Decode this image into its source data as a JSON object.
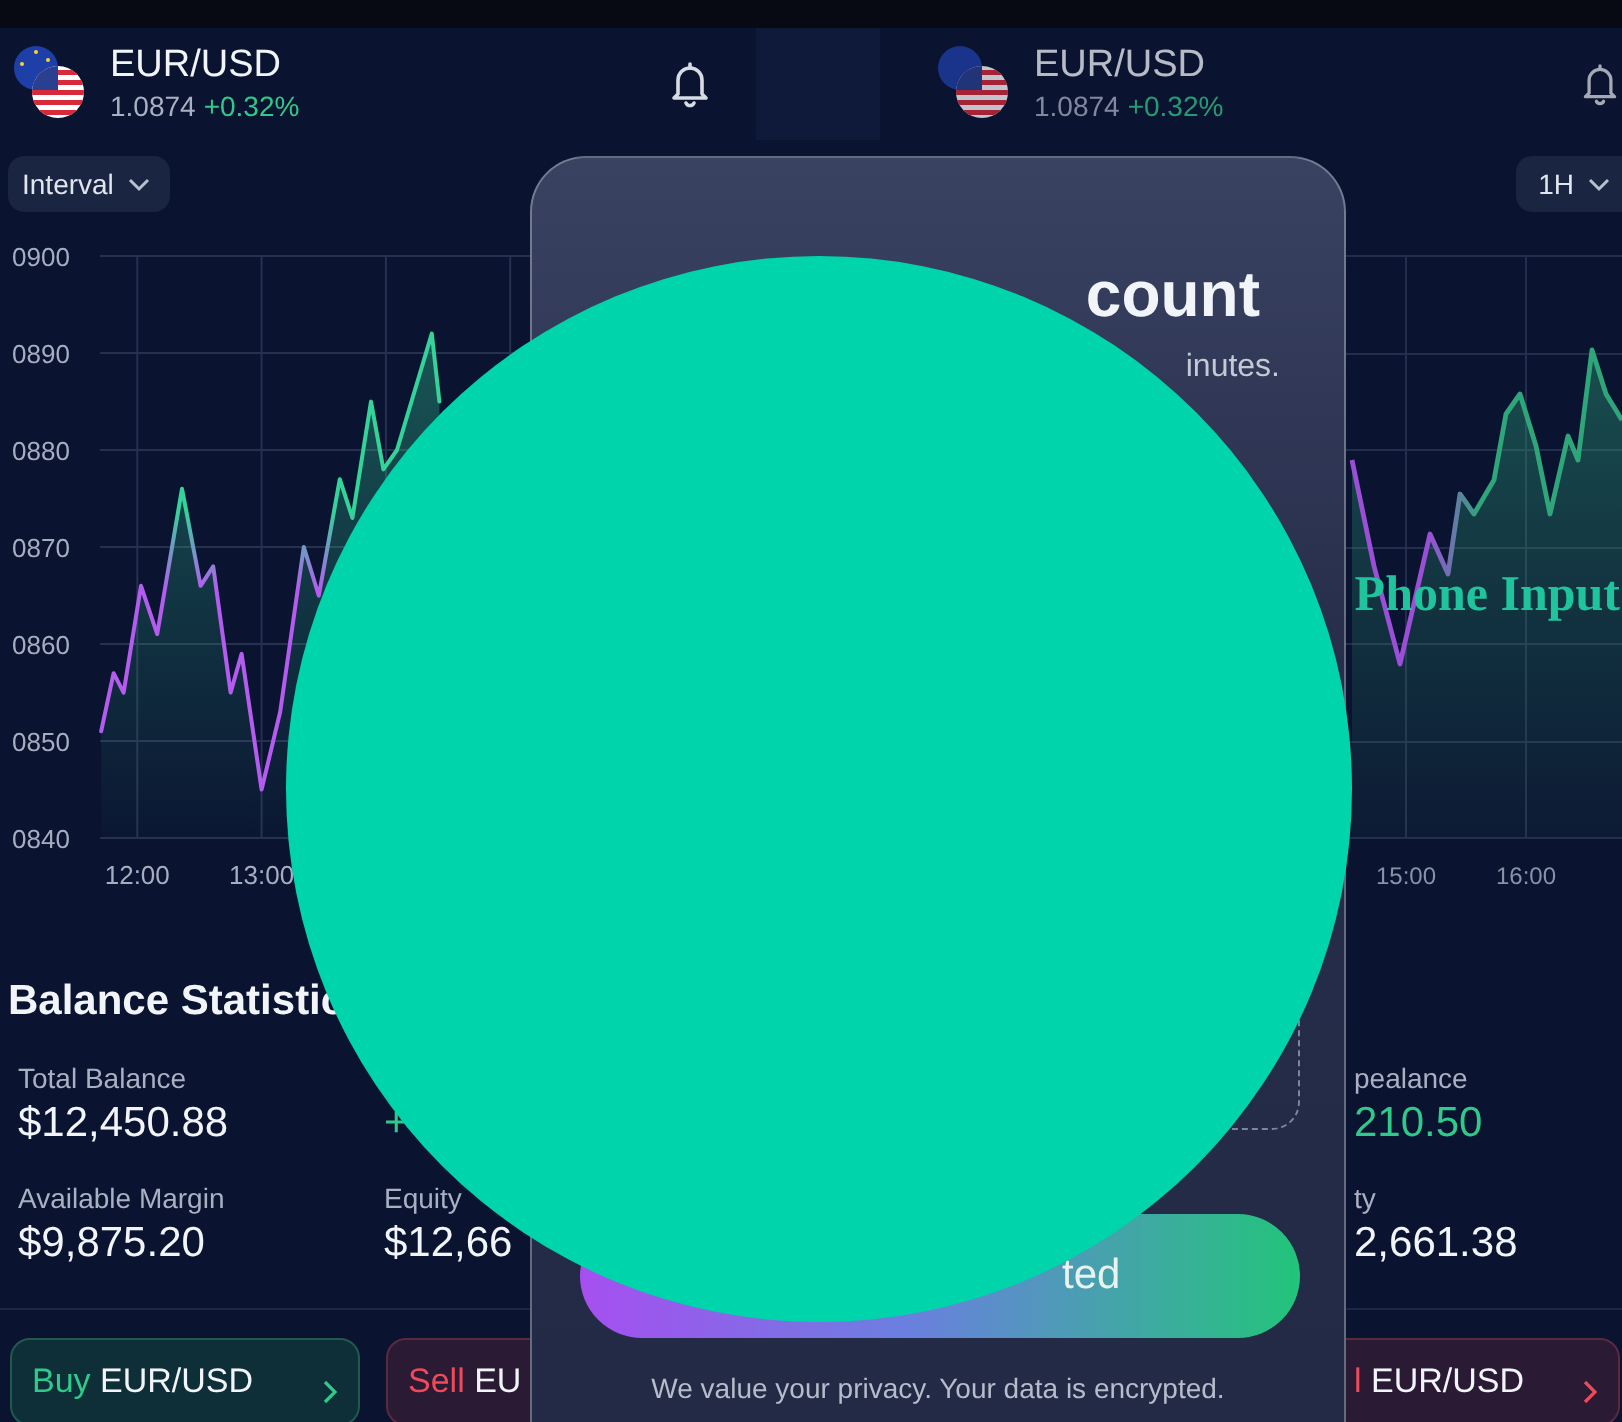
{
  "left_screen": {
    "header": {
      "pair": "EUR/USD",
      "price": "1.0874",
      "change": "+0.32%"
    },
    "interval_button": {
      "label": "Interval"
    },
    "chart": {
      "chart_data": {
        "type": "area",
        "grid": true,
        "x": [
          11.71,
          11.81,
          11.89,
          12.03,
          12.16,
          12.36,
          12.51,
          12.61,
          12.75,
          12.84,
          13.0,
          13.15,
          13.34,
          13.46,
          13.63,
          13.73,
          13.88,
          13.98,
          14.09,
          14.37,
          14.43
        ],
        "series": [
          {
            "color": "#34d399",
            "values": [
              851,
              857,
              855,
              866,
              861,
              876,
              866,
              868,
              855,
              859,
              845,
              853,
              870,
              865,
              877,
              873,
              885,
              878,
              880,
              892,
              885
            ]
          }
        ],
        "xlim": [
          11.7,
          15.24
        ],
        "xticks": [
          {
            "value": 12,
            "label": "12:00"
          },
          {
            "value": 13,
            "label": "13:00"
          }
        ],
        "yticks": [
          {
            "value": 900,
            "label": "0900"
          },
          {
            "value": 890,
            "label": "0890"
          },
          {
            "value": 880,
            "label": "0880"
          },
          {
            "value": 870,
            "label": "0870"
          },
          {
            "value": 860,
            "label": "0860"
          },
          {
            "value": 850,
            "label": "0850"
          },
          {
            "value": 840,
            "label": "0840"
          }
        ],
        "ylim": [
          840,
          900
        ]
      }
    },
    "balance": {
      "title": "Balance Statistic",
      "stats": [
        {
          "label": "Total Balance",
          "value": "$12,450.88",
          "kind": "plain"
        },
        {
          "value": "+",
          "kind": "gain"
        },
        {
          "label": "Available Margin",
          "value": "$9,875.20",
          "kind": "plain"
        },
        {
          "label": "Equity",
          "value": "$12,66",
          "kind": "plain"
        }
      ]
    },
    "trade_buttons": [
      {
        "action": "Buy",
        "pair": "EUR/USD",
        "kind": "buy"
      },
      {
        "action": "Sell",
        "pair": "EU",
        "kind": "sell"
      }
    ]
  },
  "right_screen": {
    "header": {
      "pair": "EUR/USD",
      "price": "1.0874",
      "change": "+0.32%"
    },
    "interval_button": {
      "label": "1H"
    },
    "x_labels": [
      "15:00",
      "16:00"
    ],
    "stats": [
      {
        "label": "pealance",
        "value": "210.50",
        "kind": "gain"
      },
      {
        "label": "ty",
        "value": "2,661.38",
        "kind": "plain"
      }
    ],
    "trade_buttons": [
      {
        "action": "l",
        "pair": "EUR/USD",
        "kind": "sell"
      }
    ]
  },
  "modal": {
    "title": "count",
    "subtitle": "inutes.",
    "button": {
      "label": "ted"
    },
    "note": "We value your privacy. Your data is encrypted."
  },
  "overlay_label": "Phone Input"
}
